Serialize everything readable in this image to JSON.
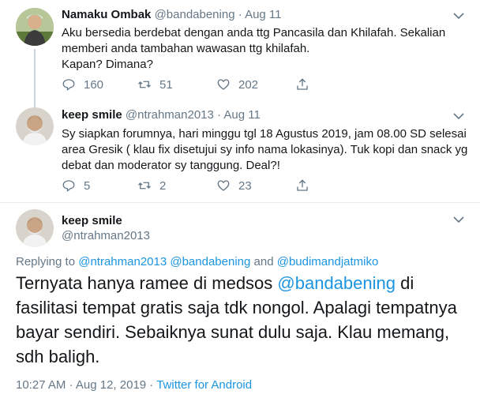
{
  "tweets": [
    {
      "name": "Namaku Ombak",
      "handle": "@bandabening",
      "dot": "·",
      "date": "Aug 11",
      "lines": [
        "Aku bersedia berdebat dengan anda ttg Pancasila dan Khilafah. Sekalian",
        "memberi anda tambahan wawasan ttg khilafah.",
        "Kapan? Dimana?"
      ],
      "replies": "160",
      "retweets": "51",
      "likes": "202",
      "avatar_color": "#6d8a4a"
    },
    {
      "name": "keep smile",
      "handle": "@ntrahman2013",
      "dot": "·",
      "date": "Aug 11",
      "lines": [
        "Sy siapkan forumnya, hari minggu tgl 18 Agustus 2019, jam 08.00 SD selesai",
        "area Gresik ( klau fix  disetujui sy info nama lokasinya). Tuk kopi dan snack yg",
        "debat dan moderator sy tanggung. Deal?!"
      ],
      "replies": "5",
      "retweets": "2",
      "likes": "23",
      "avatar_color": "#8a7a6a"
    }
  ],
  "main": {
    "name": "keep smile",
    "handle": "@ntrahman2013",
    "replying_prefix": "Replying to",
    "replying_mentions": [
      "@ntrahman2013",
      "@bandabening",
      "and",
      "@budimandjatmiko"
    ],
    "text_before": "Ternyata hanya ramee di medsos ",
    "text_mention": "@bandabening",
    "text_after": " di fasilitasi tempat gratis saja tdk nongol. Apalagi tempatnya bayar sendiri. Sebaiknya sunat dulu saja. Klau memang, sdh baligh.",
    "timestamp": "10:27 AM · Aug 12, 2019 ·",
    "source": "Twitter for Android"
  },
  "colors": {
    "link": "#1b95e0",
    "muted": "#657786",
    "divider": "#e6ecf0"
  }
}
